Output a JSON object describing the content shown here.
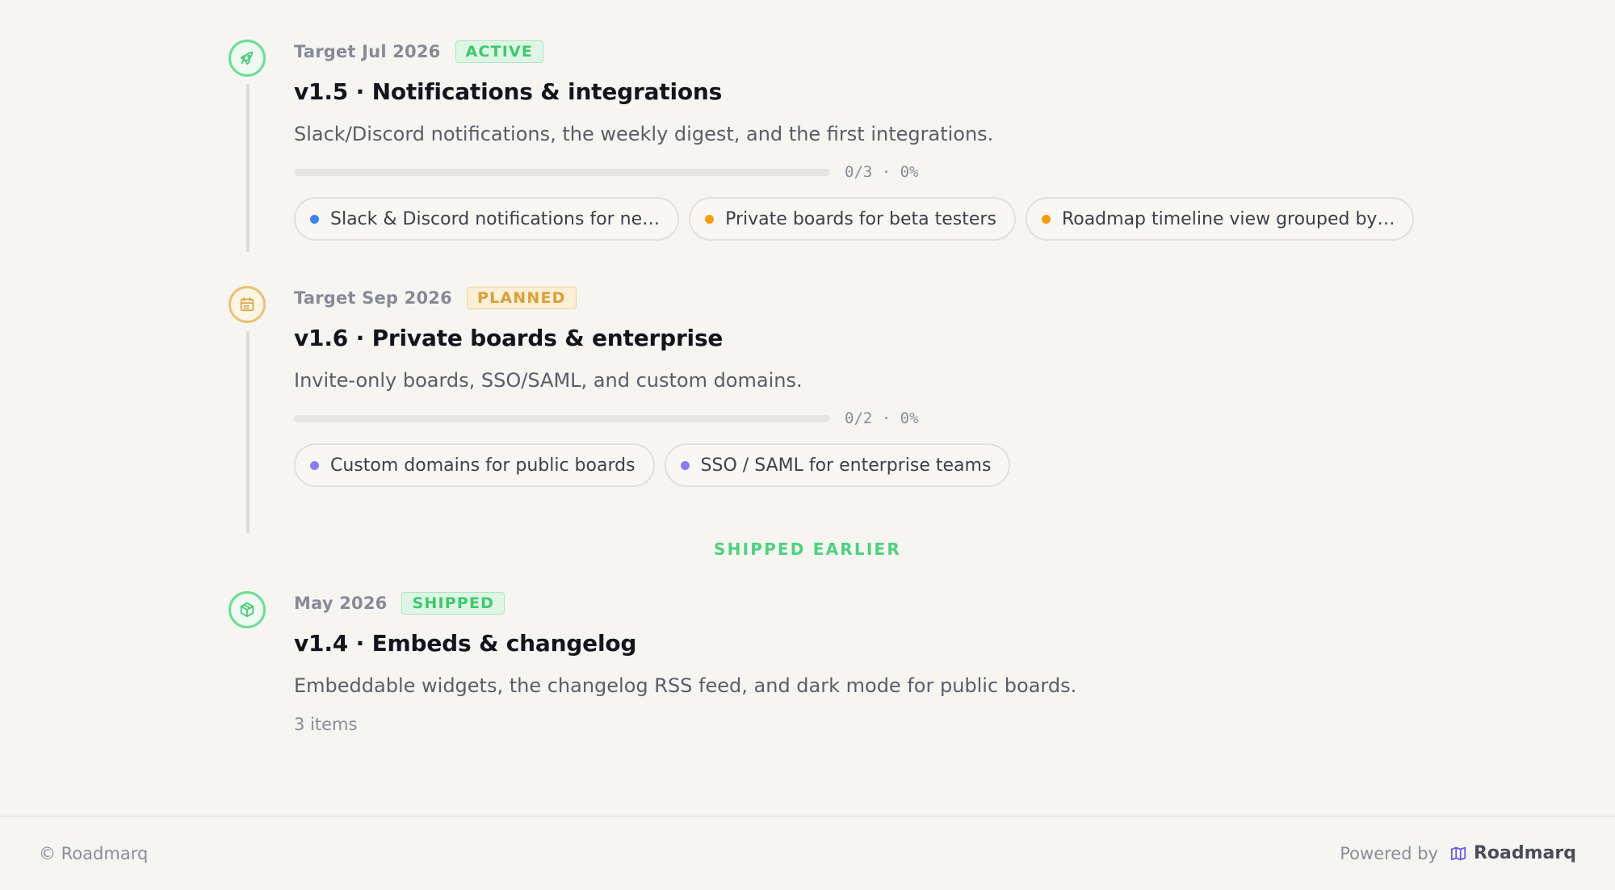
{
  "milestones": [
    {
      "target": "Target Jul 2026",
      "status": "ACTIVE",
      "title": "v1.5 · Notifications & integrations",
      "description": "Slack/Discord notifications, the weekly digest, and the first integrations.",
      "progress_text": "0/3 · 0%",
      "progress_fraction": 0,
      "icon": "rocket-icon",
      "items": [
        {
          "label": "Slack & Discord notifications for ne…",
          "color": "#3b82f6"
        },
        {
          "label": "Private boards for beta testers",
          "color": "#f59e0b"
        },
        {
          "label": "Roadmap timeline view grouped by…",
          "color": "#f59e0b"
        }
      ]
    },
    {
      "target": "Target Sep 2026",
      "status": "PLANNED",
      "title": "v1.6 · Private boards & enterprise",
      "description": "Invite-only boards, SSO/SAML, and custom domains.",
      "progress_text": "0/2 · 0%",
      "progress_fraction": 0,
      "icon": "calendar-icon",
      "items": [
        {
          "label": "Custom domains for public boards",
          "color": "#8b7cf6"
        },
        {
          "label": "SSO / SAML for enterprise teams",
          "color": "#8b7cf6"
        }
      ]
    }
  ],
  "shipped_section_label": "SHIPPED EARLIER",
  "shipped": [
    {
      "target": "May 2026",
      "status": "SHIPPED",
      "title": "v1.4 · Embeds & changelog",
      "description": "Embeddable widgets, the changelog RSS feed, and dark mode for public boards.",
      "items_count": "3 items",
      "icon": "package-icon"
    }
  ],
  "footer": {
    "copyright": "© Roadmarq",
    "powered_by": "Powered by",
    "brand": "Roadmarq",
    "brand_icon": "map-icon"
  },
  "colors": {
    "accent_green": "#4cd27d",
    "accent_amber": "#e9c274",
    "brand": "#6b5ce7"
  }
}
